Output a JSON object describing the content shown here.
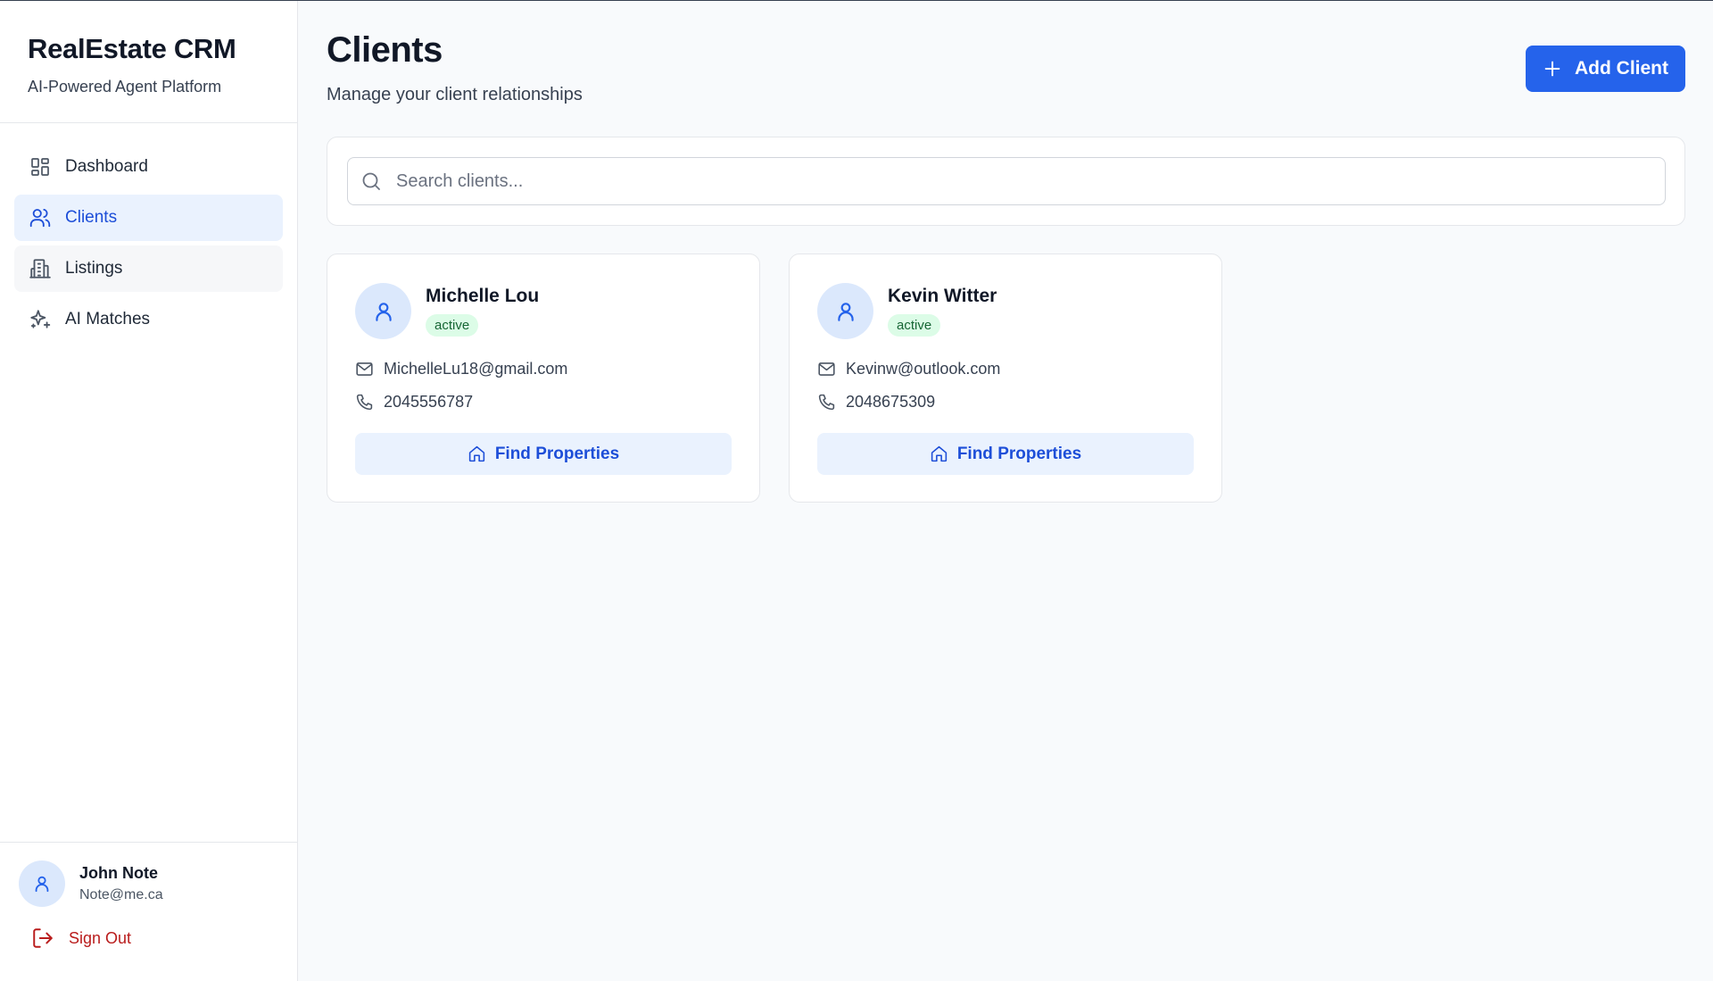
{
  "app": {
    "title": "RealEstate CRM",
    "subtitle": "AI-Powered Agent Platform"
  },
  "sidebar": {
    "items": [
      {
        "label": "Dashboard",
        "icon": "dashboard-icon",
        "active": false
      },
      {
        "label": "Clients",
        "icon": "users-icon",
        "active": true
      },
      {
        "label": "Listings",
        "icon": "building-icon",
        "active": false
      },
      {
        "label": "AI Matches",
        "icon": "sparkles-icon",
        "active": false
      }
    ]
  },
  "user": {
    "name": "John Note",
    "email": "Note@me.ca",
    "sign_out_label": "Sign Out"
  },
  "header": {
    "title": "Clients",
    "subtitle": "Manage your client relationships",
    "add_button_label": "Add Client"
  },
  "search": {
    "placeholder": "Search clients...",
    "value": ""
  },
  "clients": [
    {
      "name": "Michelle Lou",
      "status": "active",
      "email": "MichelleLu18@gmail.com",
      "phone": "2045556787",
      "action_label": "Find Properties"
    },
    {
      "name": "Kevin Witter",
      "status": "active",
      "email": "Kevinw@outlook.com",
      "phone": "2048675309",
      "action_label": "Find Properties"
    }
  ],
  "colors": {
    "accent": "#2563eb",
    "active_nav_bg": "#eaf2fe",
    "status_active_bg": "#dcfce7",
    "status_active_text": "#166534",
    "sign_out": "#b91c1c"
  }
}
